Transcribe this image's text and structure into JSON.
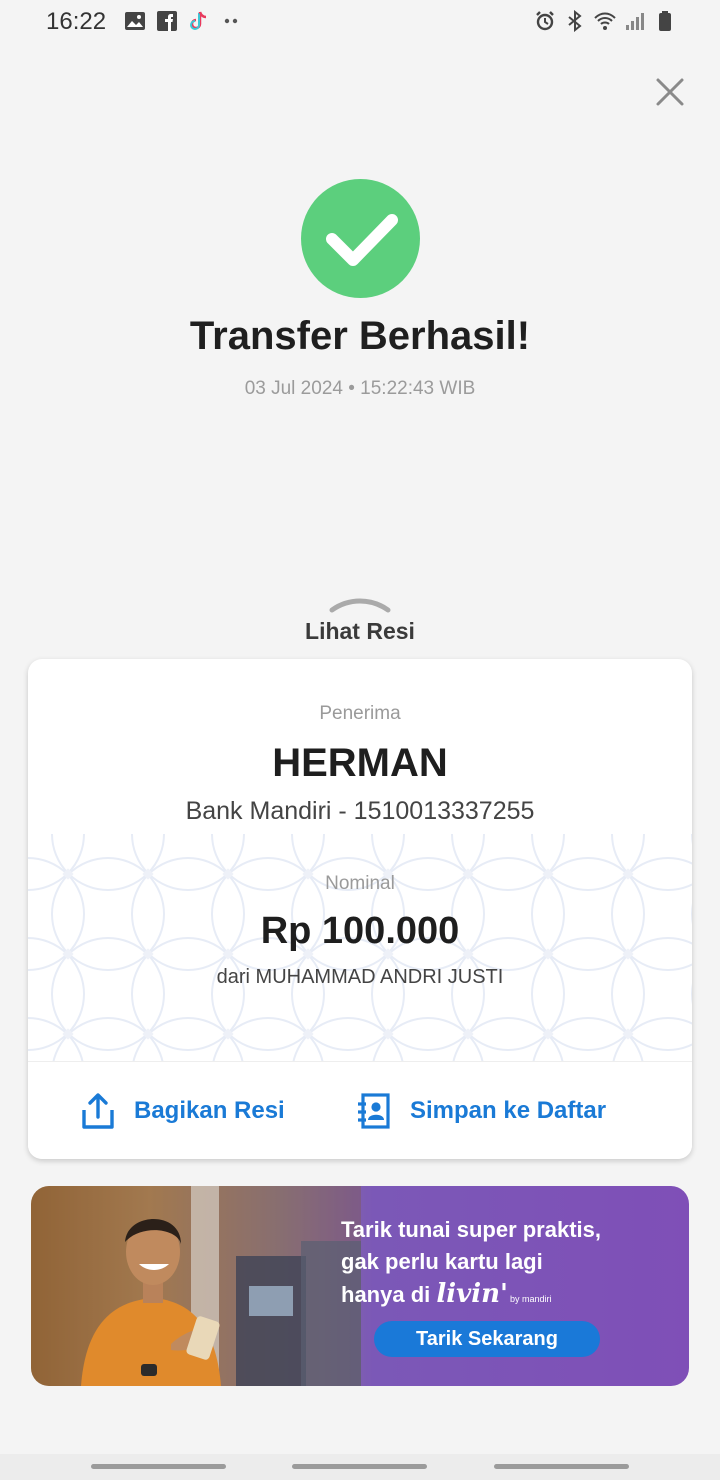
{
  "status_bar": {
    "time": "16:22",
    "left_icons": [
      "gallery-icon",
      "facebook-icon",
      "tiktok-icon",
      "more-dots-icon"
    ],
    "right_icons": [
      "alarm-icon",
      "bluetooth-icon",
      "wifi-icon",
      "signal-icon",
      "battery-icon"
    ]
  },
  "header": {
    "close_icon": "close-icon"
  },
  "result": {
    "icon": "checkmark-icon",
    "status_color": "#5ccf7d",
    "title": "Transfer Berhasil!",
    "datetime": "03 Jul 2024 • 15:22:43 WIB"
  },
  "receipt_toggle": {
    "label": "Lihat Resi",
    "icon": "chevron-up-icon"
  },
  "receipt": {
    "recipient_label": "Penerima",
    "recipient_name": "HERMAN",
    "recipient_bank": "Bank Mandiri - 1510013337255",
    "amount_label": "Nominal",
    "amount": "Rp 100.000",
    "sender": "dari MUHAMMAD ANDRI JUSTI"
  },
  "actions": {
    "share_label": "Bagikan Resi",
    "share_icon": "share-icon",
    "save_label": "Simpan ke Daftar",
    "save_icon": "add-contact-icon",
    "accent_color": "#1a7ad6"
  },
  "promo": {
    "line1": "Tarik tunai super praktis,",
    "line2": "gak perlu kartu lagi",
    "line3_prefix": "hanya di",
    "brand": "livin'",
    "brand_sub": "by mandiri",
    "cta": "Tarik Sekarang"
  }
}
